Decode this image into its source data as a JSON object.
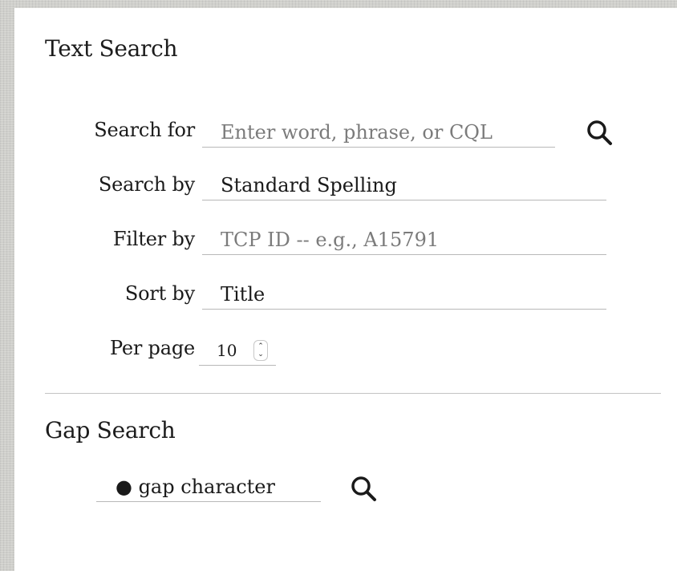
{
  "text_search": {
    "title": "Text Search",
    "search_for": {
      "label": "Search for",
      "placeholder": "Enter word, phrase, or CQL"
    },
    "search_by": {
      "label": "Search by",
      "value": "Standard Spelling"
    },
    "filter_by": {
      "label": "Filter by",
      "placeholder": "TCP ID -- e.g., A15791"
    },
    "sort_by": {
      "label": "Sort by",
      "value": "Title"
    },
    "per_page": {
      "label": "Per page",
      "value": "10"
    }
  },
  "gap_search": {
    "title": "Gap Search",
    "value": "● gap character"
  },
  "icons": {
    "search": "search-icon",
    "stepper": "stepper-icon"
  },
  "colors": {
    "text": "#1a1a1a",
    "placeholder": "#7b7b7b",
    "underline": "#b8b8b8"
  }
}
